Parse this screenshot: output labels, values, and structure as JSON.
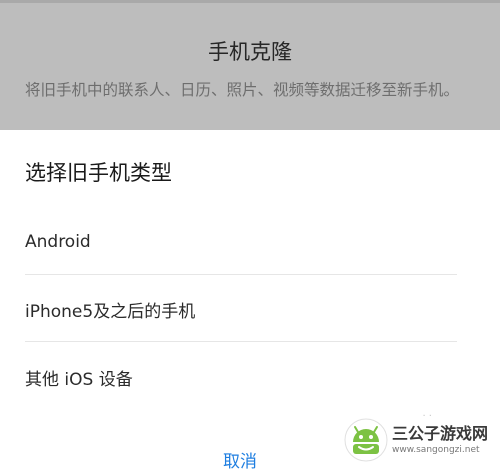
{
  "background_page": {
    "title": "手机克隆",
    "description": "将旧手机中的联系人、日历、照片、视频等数据迁移至新手机。"
  },
  "sheet": {
    "title": "选择旧手机类型",
    "options": [
      {
        "label": "Android"
      },
      {
        "label": "iPhone5及之后的手机"
      },
      {
        "label": "其他 iOS 设备"
      }
    ],
    "cancel_label": "取消"
  },
  "watermark": {
    "name": "三公子游戏网",
    "url": "www.sangongzi.net",
    "icon": "android-robot-icon"
  },
  "colors": {
    "accent": "#1e7ee0",
    "backdrop": "#bdbdbd",
    "divider": "#e6e6e6"
  }
}
